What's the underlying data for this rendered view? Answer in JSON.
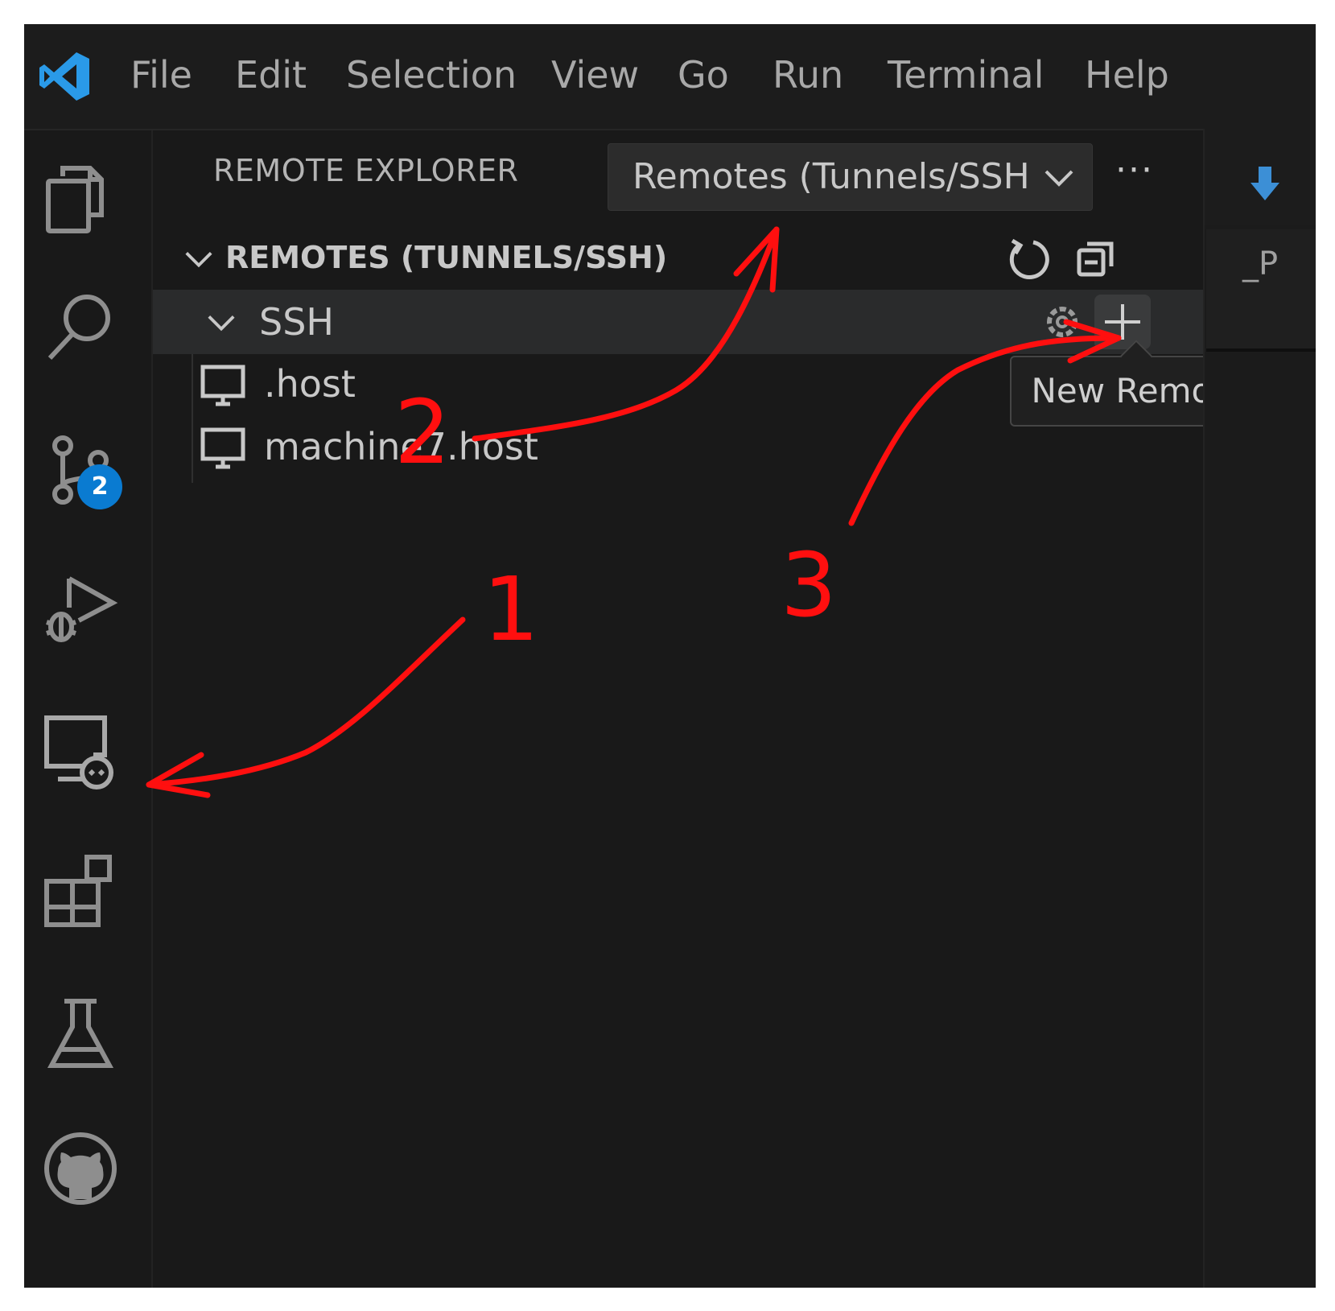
{
  "menu": {
    "items": [
      "File",
      "Edit",
      "Selection",
      "View",
      "Go",
      "Run",
      "Terminal",
      "Help"
    ]
  },
  "activity_bar": {
    "icons": [
      "files-icon",
      "search-icon",
      "source-control-icon",
      "run-debug-icon",
      "remote-explorer-icon",
      "extensions-icon",
      "testing-icon",
      "github-icon"
    ],
    "source_control_badge": "2"
  },
  "side_panel": {
    "title": "REMOTE EXPLORER",
    "dropdown_value": "Remotes (Tunnels/SSH",
    "more_label": "···",
    "section_title": "REMOTES (TUNNELS/SSH)",
    "group_label": "SSH",
    "hosts": [
      ".host",
      "machine7.host"
    ],
    "tooltip": "New Remote"
  },
  "editor": {
    "fragment": "_P"
  },
  "annotations": {
    "labels": [
      "1",
      "2",
      "3"
    ],
    "color": "#ff0f0f"
  },
  "colors": {
    "background": "#191919",
    "accent_blue": "#0a7bd1",
    "text": "#c8c8c8"
  }
}
